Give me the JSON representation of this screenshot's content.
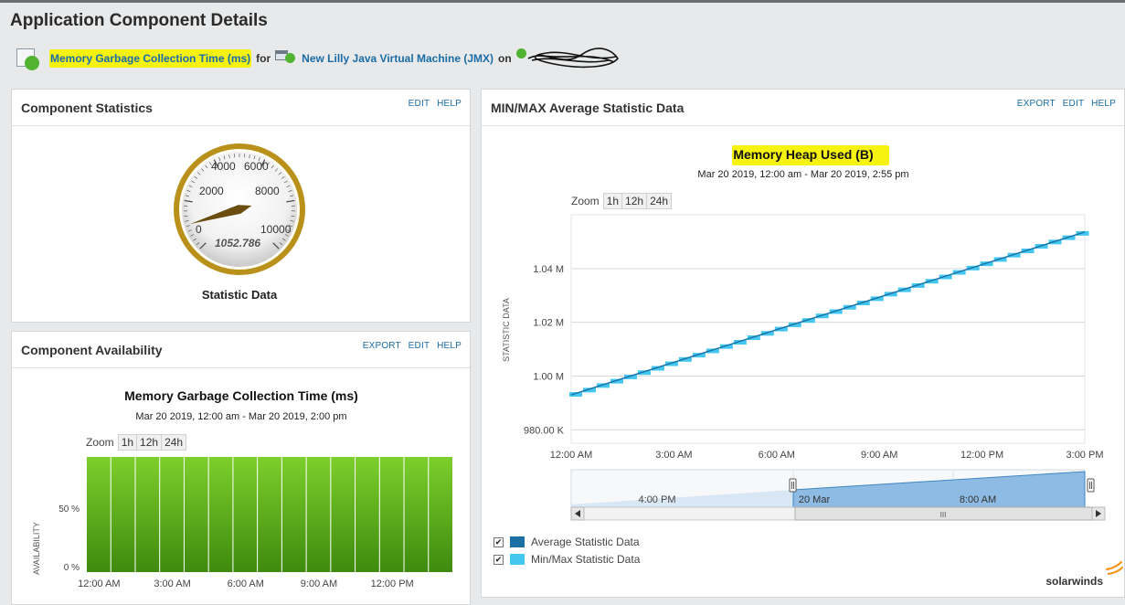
{
  "page": {
    "title": "Application Component Details"
  },
  "breadcrumb": {
    "component_link": "Memory Garbage Collection Time (ms)",
    "for_text": "for",
    "application_link": "New Lilly Java Virtual Machine (JMX)",
    "on_text": "on"
  },
  "component_statistics": {
    "title": "Component Statistics",
    "actions": [
      "EDIT",
      "HELP"
    ],
    "gauge": {
      "value": 1052.786,
      "value_label": "1052.786",
      "min": 0,
      "max": 10000,
      "tick_labels": [
        "0",
        "2000",
        "4000",
        "6000",
        "8000",
        "10000"
      ],
      "caption": "Statistic Data"
    }
  },
  "component_availability": {
    "title": "Component Availability",
    "actions": [
      "EXPORT",
      "EDIT",
      "HELP"
    ],
    "zoom": {
      "label": "Zoom",
      "options": [
        "1h",
        "12h",
        "24h"
      ]
    }
  },
  "minmax_panel": {
    "title": "MIN/MAX Average Statistic Data",
    "actions": [
      "EXPORT",
      "EDIT",
      "HELP"
    ],
    "zoom": {
      "label": "Zoom",
      "options": [
        "1h",
        "12h",
        "24h"
      ]
    },
    "legend": [
      {
        "label": "Average Statistic Data",
        "color": "#1a6fa3",
        "checked": true
      },
      {
        "label": "Min/Max Statistic Data",
        "color": "#43c7f0",
        "checked": true
      }
    ],
    "navigator": {
      "labels": [
        "4:00 PM",
        "20 Mar",
        "8:00 AM"
      ],
      "grip_label": "III"
    },
    "brand": "solarwinds"
  },
  "colors": {
    "link": "#1a6ca8",
    "highlight": "#f5f30f",
    "availability_green": "#5fae1e",
    "heap_line": "#1a6fa3",
    "heap_minmax": "#43c7f0",
    "brand_orange": "#f7941d"
  },
  "chart_data": [
    {
      "type": "bar",
      "title": "Memory Garbage Collection Time (ms)",
      "subtitle": "Mar 20 2019, 12:00 am - Mar 20 2019, 2:00 pm",
      "ylabel": "AVAILABILITY",
      "xlabel": "",
      "y_tick_labels": [
        "0 %",
        "50 %"
      ],
      "x_tick_labels": [
        "12:00 AM",
        "3:00 AM",
        "6:00 AM",
        "9:00 AM",
        "12:00 PM"
      ],
      "ylim": [
        0,
        100
      ],
      "x": [
        0,
        1,
        2,
        3,
        4,
        5,
        6,
        7,
        8,
        9,
        10,
        11,
        12,
        13,
        14
      ],
      "x_units": "hours since 12:00 AM",
      "values": [
        100,
        100,
        100,
        100,
        100,
        100,
        100,
        100,
        100,
        100,
        100,
        100,
        100,
        100,
        100
      ],
      "grid": false
    },
    {
      "type": "line",
      "title": "Memory Heap Used (B)",
      "subtitle": "Mar 20 2019, 12:00 am - Mar 20 2019, 2:55 pm",
      "ylabel": "STATISTIC DATA",
      "xlabel": "",
      "y_tick_labels": [
        "980.00 K",
        "1.00 M",
        "1.02 M",
        "1.04 M"
      ],
      "y_ticks": [
        980000,
        1000000,
        1020000,
        1040000
      ],
      "x_tick_labels": [
        "12:00 AM",
        "3:00 AM",
        "6:00 AM",
        "9:00 AM",
        "12:00 PM",
        "3:00 PM"
      ],
      "x_ticks": [
        0,
        3,
        6,
        9,
        12,
        15
      ],
      "xlim": [
        0,
        15
      ],
      "ylim": [
        975000,
        1060000
      ],
      "grid": true,
      "legend_position": "bottom-left",
      "series": [
        {
          "name": "Average Statistic Data",
          "x": [
            0,
            15
          ],
          "values": [
            993000,
            1053600
          ]
        },
        {
          "name": "Min/Max Statistic Data",
          "x": [
            0.0,
            0.4,
            0.8,
            1.2,
            1.6,
            2.0,
            2.4,
            2.8,
            3.2,
            3.6,
            4.0,
            4.4,
            4.8,
            5.2,
            5.6,
            6.0,
            6.4,
            6.8,
            7.2,
            7.6,
            8.0,
            8.4,
            8.8,
            9.2,
            9.6,
            10.0,
            10.4,
            10.8,
            11.2,
            11.6,
            12.0,
            12.4,
            12.8,
            13.2,
            13.6,
            14.0,
            14.4,
            14.8
          ],
          "values": [
            993000,
            994600,
            996300,
            997900,
            999500,
            1001100,
            1002700,
            1004400,
            1006000,
            1007600,
            1009200,
            1010800,
            1012400,
            1014100,
            1015700,
            1017300,
            1018900,
            1020500,
            1022200,
            1023800,
            1025400,
            1027000,
            1028600,
            1030300,
            1031900,
            1033500,
            1035100,
            1036700,
            1038400,
            1040000,
            1041600,
            1043200,
            1044800,
            1046400,
            1048100,
            1049700,
            1051300,
            1052900
          ]
        }
      ]
    }
  ]
}
